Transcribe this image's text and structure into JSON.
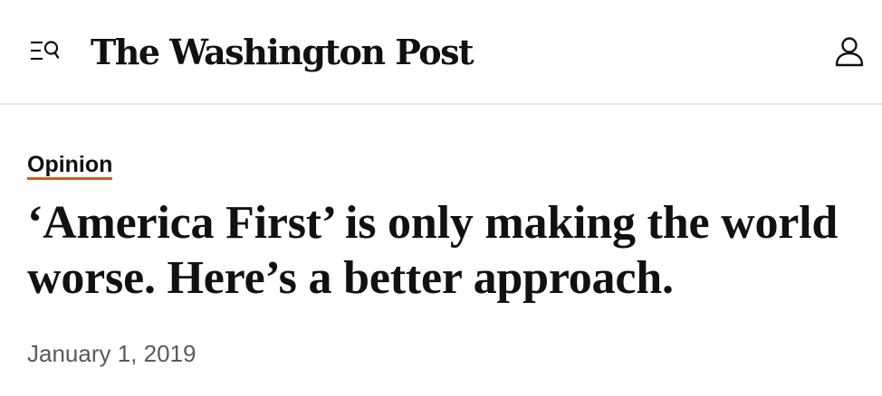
{
  "header": {
    "menu_icon": "menu-search-icon",
    "logo_text": "The Washington Post",
    "account_icon": "user-icon"
  },
  "article": {
    "section": "Opinion",
    "headline": "‘America First’ is only making the world worse. Here’s a better approach.",
    "date": "January 1, 2019"
  },
  "colors": {
    "text": "#111111",
    "date_text": "#5a5a5a",
    "kicker_underline": "#c95f22",
    "divider": "#e5e5e5"
  }
}
